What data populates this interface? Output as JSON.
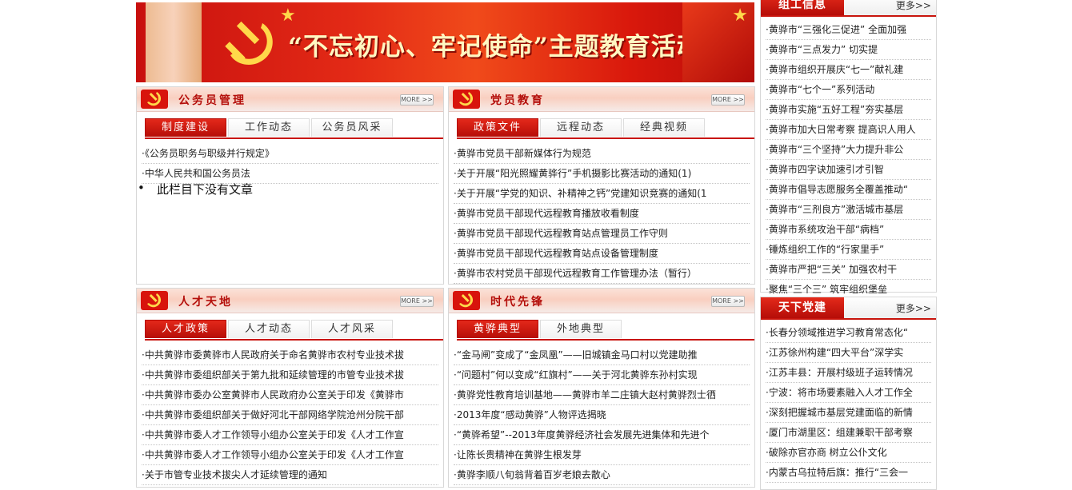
{
  "banner": {
    "title": "“不忘初心、牢记使命”主题教育活动"
  },
  "colors": {
    "brand_red": "#c8140c",
    "gold": "#ffd84a"
  },
  "gwy": {
    "title": "公务员管理",
    "more": "MORE >>",
    "tabs": [
      "制度建设",
      "工作动态",
      "公务员风采"
    ],
    "items": [
      "·《公务员职务与职级并行规定》",
      "·中华人民共和国公务员法"
    ],
    "empty": "此栏目下没有文章"
  },
  "dyjy": {
    "title": "党员教育",
    "more": "MORE >>",
    "tabs": [
      "政策文件",
      "远程动态",
      "经典视频"
    ],
    "items": [
      "·黄骅市党员干部新媒体行为规范",
      "·关于开展“阳光照耀黄骅行”手机摄影比赛活动的通知(1)",
      "·关于开展“学党的知识、补精神之钙”党建知识竞赛的通知(1",
      "·黄骅市党员干部现代远程教育播放收看制度",
      "·黄骅市党员干部现代远程教育站点管理员工作守则",
      "·黄骅市党员干部现代远程教育站点设备管理制度",
      "·黄骅市农村党员干部现代远程教育工作管理办法（暂行）"
    ]
  },
  "rctd": {
    "title": "人才天地",
    "more": "MORE >>",
    "tabs": [
      "人才政策",
      "人才动态",
      "人才风采"
    ],
    "items": [
      "·中共黄骅市委黄骅市人民政府关于命名黄骅市农村专业技术拔",
      "·中共黄骅市委组织部关于第九批和延续管理的市管专业技术拔",
      "·中共黄骅市委办公室黄骅市人民政府办公室关于印发《黄骅市",
      "·中共黄骅市委组织部关于做好河北干部网络学院沧州分院干部",
      "·中共黄骅市委人才工作领导小组办公室关于印发《人才工作宣",
      "·中共黄骅市委人才工作领导小组办公室关于印发《人才工作宣",
      "·关于市管专业技术拔尖人才延续管理的通知"
    ]
  },
  "sdxf": {
    "title": "时代先锋",
    "more": "MORE >>",
    "tabs": [
      "黄骅典型",
      "外地典型"
    ],
    "items": [
      "·“金马闸”变成了“金凤凰”——旧城镇金马口村以党建助推",
      "·“问题村”何以变成“红旗村”——关于河北黄骅东孙村实现",
      "·黄骅党性教育培训基地——黄骅市羊二庄镇大赵村黄骅烈士徆",
      "·2013年度“感动黄骅”人物评选揭晓",
      "·“黄骅希望”--2013年度黄骅经济社会发展先进集体和先进个",
      "·让陈长贵精神在黄骅生根发芽",
      "·黄骅李顺八旬翁背着百岁老娘去散心"
    ]
  },
  "zgxx": {
    "title": "组工信息",
    "more": "更多>>",
    "items": [
      "·黄骅市“三强化三促进” 全面加强",
      "·黄骅市“三点发力” 切实提",
      "·黄骅市组织开展庆“七一”献礼建",
      "·黄骅市“七个一”系列活动",
      "·黄骅市实施“五好工程”夯实基层",
      "·黄骅市加大日常考察 提高识人用人",
      "·黄骅市“三个坚持”大力提升非公",
      "·黄骅市四字诀加速引才引智",
      "·黄骅市倡导志愿服务全覆盖推动“",
      "·黄骅市“三剂良方”激活城市基层",
      "·黄骅市系统攻治干部“病档”",
      "·锤炼组织工作的“行家里手”",
      "·黄骅市严把“三关” 加强农村干",
      "·聚焦“三个三” 筑牢组织堡垒"
    ]
  },
  "txdj": {
    "title": "天下党建",
    "more": "更多>>",
    "items": [
      "·长春分领域推进学习教育常态化“",
      "·江苏徐州构建“四大平台”深学实",
      "·江苏丰县：开展村级班子运转情况",
      "·宁波：将市场要素融入人才工作全",
      "·深刻把握城市基层党建面临的新情",
      "·厦门市湖里区：组建兼职干部考察",
      "·破除亦官亦商 树立公仆文化",
      "·内蒙古乌拉特后旗：推行“三会一"
    ]
  }
}
